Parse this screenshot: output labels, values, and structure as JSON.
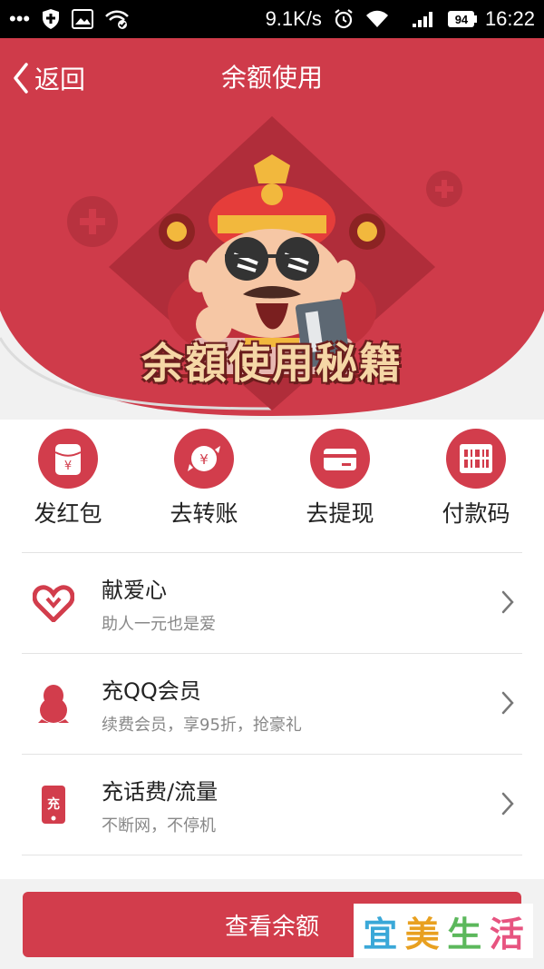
{
  "status_bar": {
    "speed": "9.1K/s",
    "battery": "94",
    "time": "16:22",
    "dots": "•••"
  },
  "nav": {
    "back_label": "返回",
    "title": "余额使用"
  },
  "hero": {
    "banner_text": "余額使用秘籍"
  },
  "actions": [
    {
      "label": "发红包",
      "icon": "red-envelope-icon"
    },
    {
      "label": "去转账",
      "icon": "transfer-icon"
    },
    {
      "label": "去提现",
      "icon": "card-icon"
    },
    {
      "label": "付款码",
      "icon": "barcode-icon"
    }
  ],
  "list": [
    {
      "title": "献爱心",
      "subtitle": "助人一元也是爱",
      "icon": "heart-icon"
    },
    {
      "title": "充QQ会员",
      "subtitle": "续费会员，享95折，抢豪礼",
      "icon": "penguin-icon"
    },
    {
      "title": "充话费/流量",
      "subtitle": "不断网，不停机",
      "icon": "phone-icon"
    }
  ],
  "button": {
    "label": "查看余额"
  },
  "watermark": {
    "chars": [
      "宜",
      "美",
      "生",
      "活"
    ]
  },
  "colors": {
    "primary": "#d23d4c",
    "hero_bg": "#cf3b4a",
    "gold": "#f2b83d"
  }
}
